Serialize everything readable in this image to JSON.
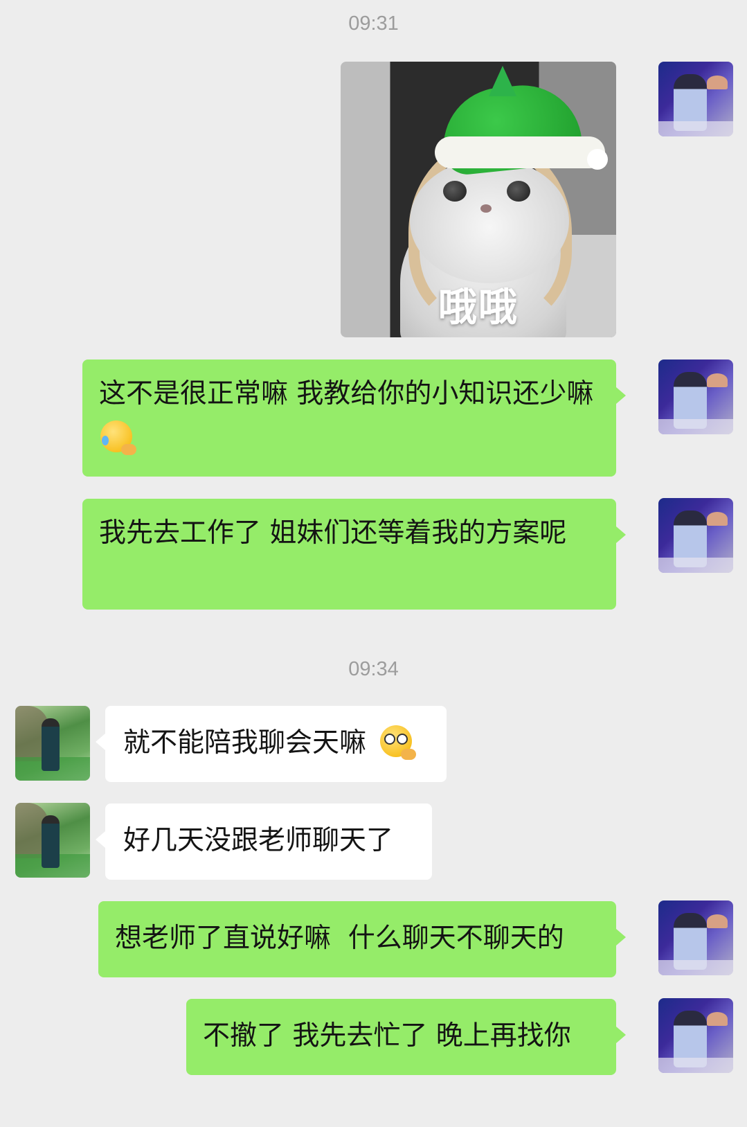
{
  "timestamps": [
    "09:31",
    "09:34"
  ],
  "sticker": {
    "caption": "哦哦",
    "description_icon": "cat-in-green-hat-sticker"
  },
  "messages": [
    {
      "side": "me",
      "text": "这不是很正常嘛 我教给你的小知识还少嘛",
      "emoji": "face-with-tears-of-joy-hand"
    },
    {
      "side": "me",
      "text": "我先去工作了 姐妹们还等着我的方案呢"
    },
    {
      "side": "them",
      "text": "就不能陪我聊会天嘛",
      "emoji": "pleading-face-hand"
    },
    {
      "side": "them",
      "text": "好几天没跟老师聊天了"
    },
    {
      "side": "me",
      "text": "想老师了直说好嘛  什么聊天不聊天的"
    },
    {
      "side": "me",
      "text": "不撤了 我先去忙了 晚上再找你"
    }
  ],
  "colors": {
    "background": "#ededed",
    "my_bubble": "#95ec69",
    "their_bubble": "#ffffff",
    "timestamp": "#9c9c9c"
  }
}
